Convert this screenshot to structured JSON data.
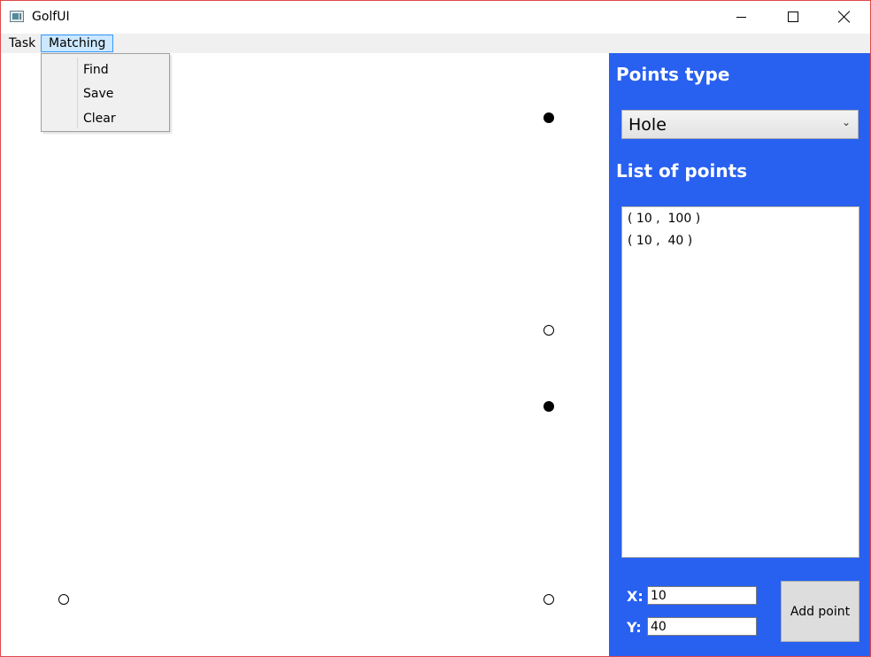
{
  "window": {
    "title": "GolfUI",
    "border_color": "#e04848"
  },
  "titlebar": {
    "icon": "app-window-icon",
    "minimize_icon": "minimize-icon",
    "maximize_icon": "maximize-icon",
    "close_icon": "close-icon"
  },
  "menubar": {
    "items": [
      {
        "label": "Task"
      },
      {
        "label": "Matching",
        "open": true
      }
    ]
  },
  "dropdown": {
    "items": [
      {
        "label": "Find"
      },
      {
        "label": "Save"
      },
      {
        "label": "Clear"
      }
    ]
  },
  "canvas": {
    "points": [
      {
        "style": "filled"
      },
      {
        "style": "hollow"
      },
      {
        "style": "filled"
      },
      {
        "style": "hollow"
      },
      {
        "style": "hollow"
      }
    ]
  },
  "panel": {
    "background": "#2860f0",
    "points_type_heading": "Points type",
    "points_type_value": "Hole",
    "list_heading": "List of points",
    "list_items": [
      "( 10 ,  100 )",
      "( 10 ,  40 )"
    ],
    "x_label": "X:",
    "x_value": "10",
    "y_label": "Y:",
    "y_value": "40",
    "add_button_label": "Add point"
  }
}
